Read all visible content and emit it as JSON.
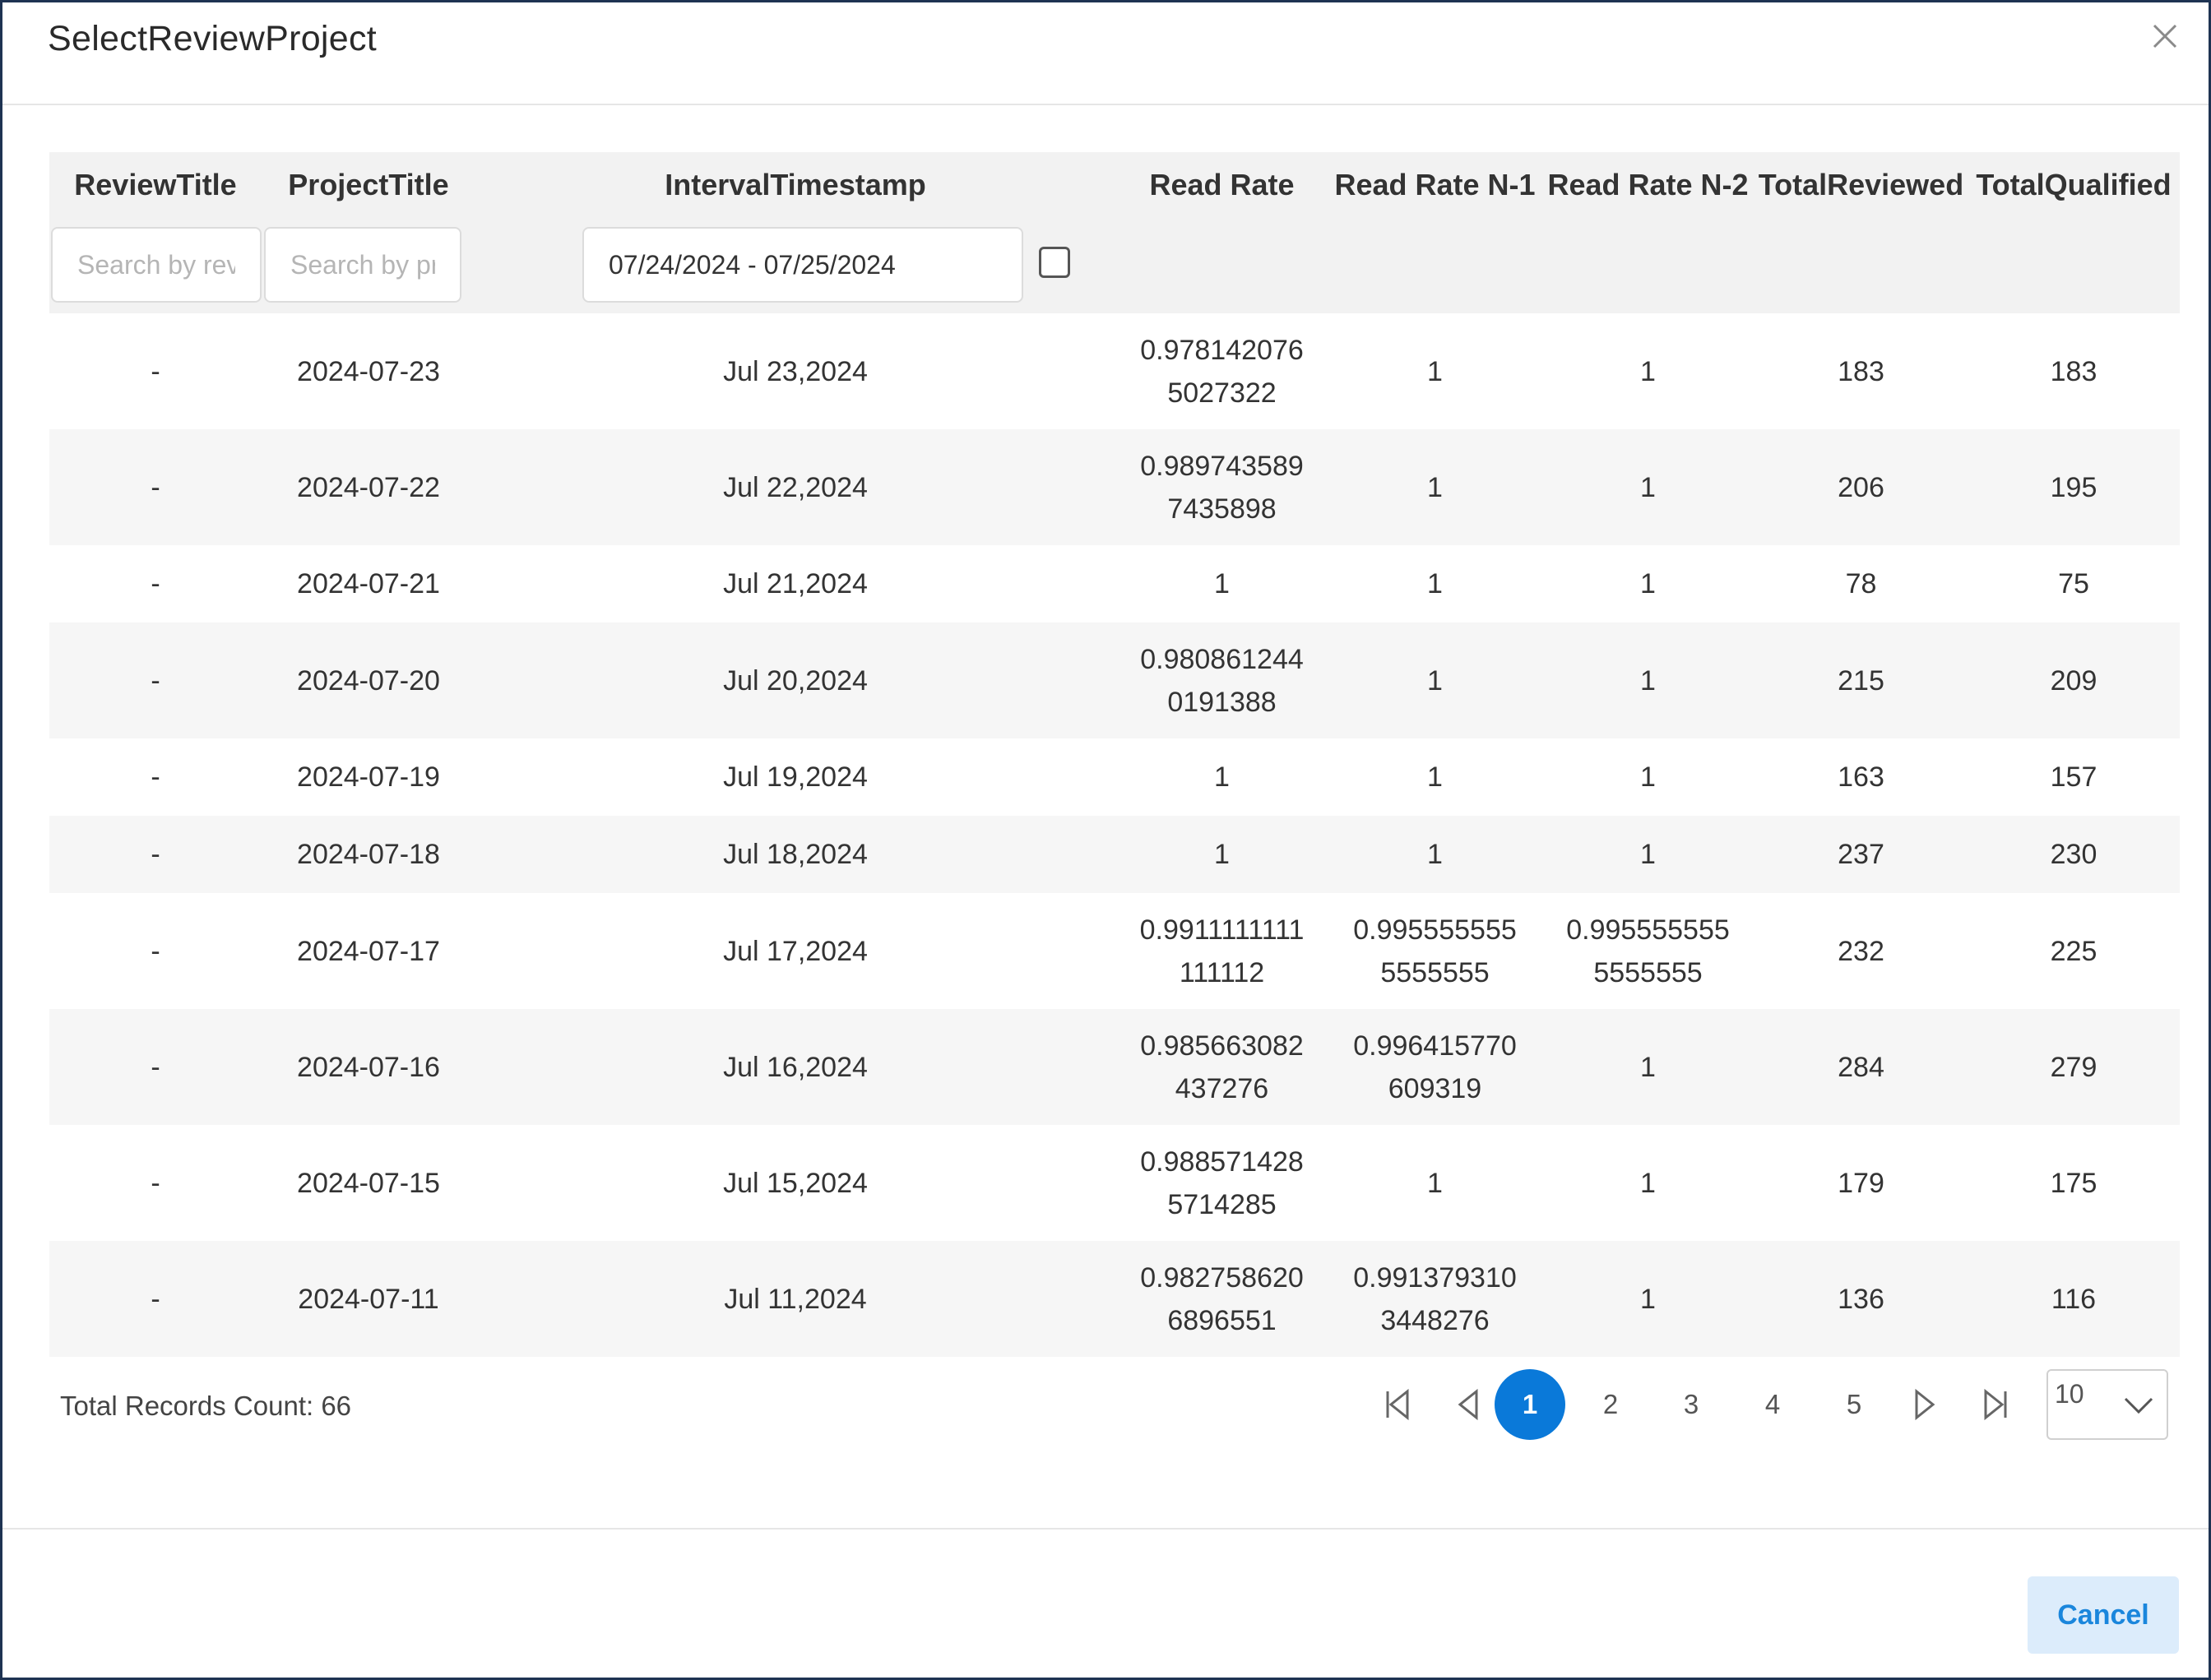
{
  "dialog": {
    "title": "SelectReviewProject",
    "cancel_label": "Cancel"
  },
  "columns": [
    "ReviewTitle",
    "ProjectTitle",
    "IntervalTimestamp",
    "Read Rate",
    "Read Rate N-1",
    "Read Rate N-2",
    "TotalReviewed",
    "TotalQualified"
  ],
  "filters": {
    "review_placeholder": "Search by review title",
    "project_placeholder": "Search by project title",
    "date_range_value": "07/24/2024 - 07/25/2024"
  },
  "rows": [
    [
      "-",
      "2024-07-23",
      "Jul 23,2024",
      "0.9781420765027322",
      "1",
      "1",
      "183",
      "183"
    ],
    [
      "-",
      "2024-07-22",
      "Jul 22,2024",
      "0.9897435897435898",
      "1",
      "1",
      "206",
      "195"
    ],
    [
      "-",
      "2024-07-21",
      "Jul 21,2024",
      "1",
      "1",
      "1",
      "78",
      "75"
    ],
    [
      "-",
      "2024-07-20",
      "Jul 20,2024",
      "0.9808612440191388",
      "1",
      "1",
      "215",
      "209"
    ],
    [
      "-",
      "2024-07-19",
      "Jul 19,2024",
      "1",
      "1",
      "1",
      "163",
      "157"
    ],
    [
      "-",
      "2024-07-18",
      "Jul 18,2024",
      "1",
      "1",
      "1",
      "237",
      "230"
    ],
    [
      "-",
      "2024-07-17",
      "Jul 17,2024",
      "0.9911111111111112",
      "0.9955555555555555",
      "0.9955555555555555",
      "232",
      "225"
    ],
    [
      "-",
      "2024-07-16",
      "Jul 16,2024",
      "0.985663082437276",
      "0.996415770609319",
      "1",
      "284",
      "279"
    ],
    [
      "-",
      "2024-07-15",
      "Jul 15,2024",
      "0.9885714285714285",
      "1",
      "1",
      "179",
      "175"
    ],
    [
      "-",
      "2024-07-11",
      "Jul 11,2024",
      "0.9827586206896551",
      "0.9913793103448276",
      "1",
      "136",
      "116"
    ]
  ],
  "footer": {
    "records_text": "Total Records Count: 66",
    "pages": [
      "1",
      "2",
      "3",
      "4",
      "5"
    ],
    "current_page": "1",
    "page_size": "10"
  },
  "icons": {
    "close": "close-icon",
    "first": "first-page-icon",
    "prev": "previous-page-icon",
    "next": "next-page-icon",
    "last": "last-page-icon",
    "dropdown": "chevron-down-icon"
  },
  "colors": {
    "accent": "#0a79d9",
    "cancel_bg": "#dcecfb",
    "cancel_text": "#1a86dc",
    "header_bg": "#f2f2f2",
    "alt_row_bg": "#f6f6f6"
  }
}
